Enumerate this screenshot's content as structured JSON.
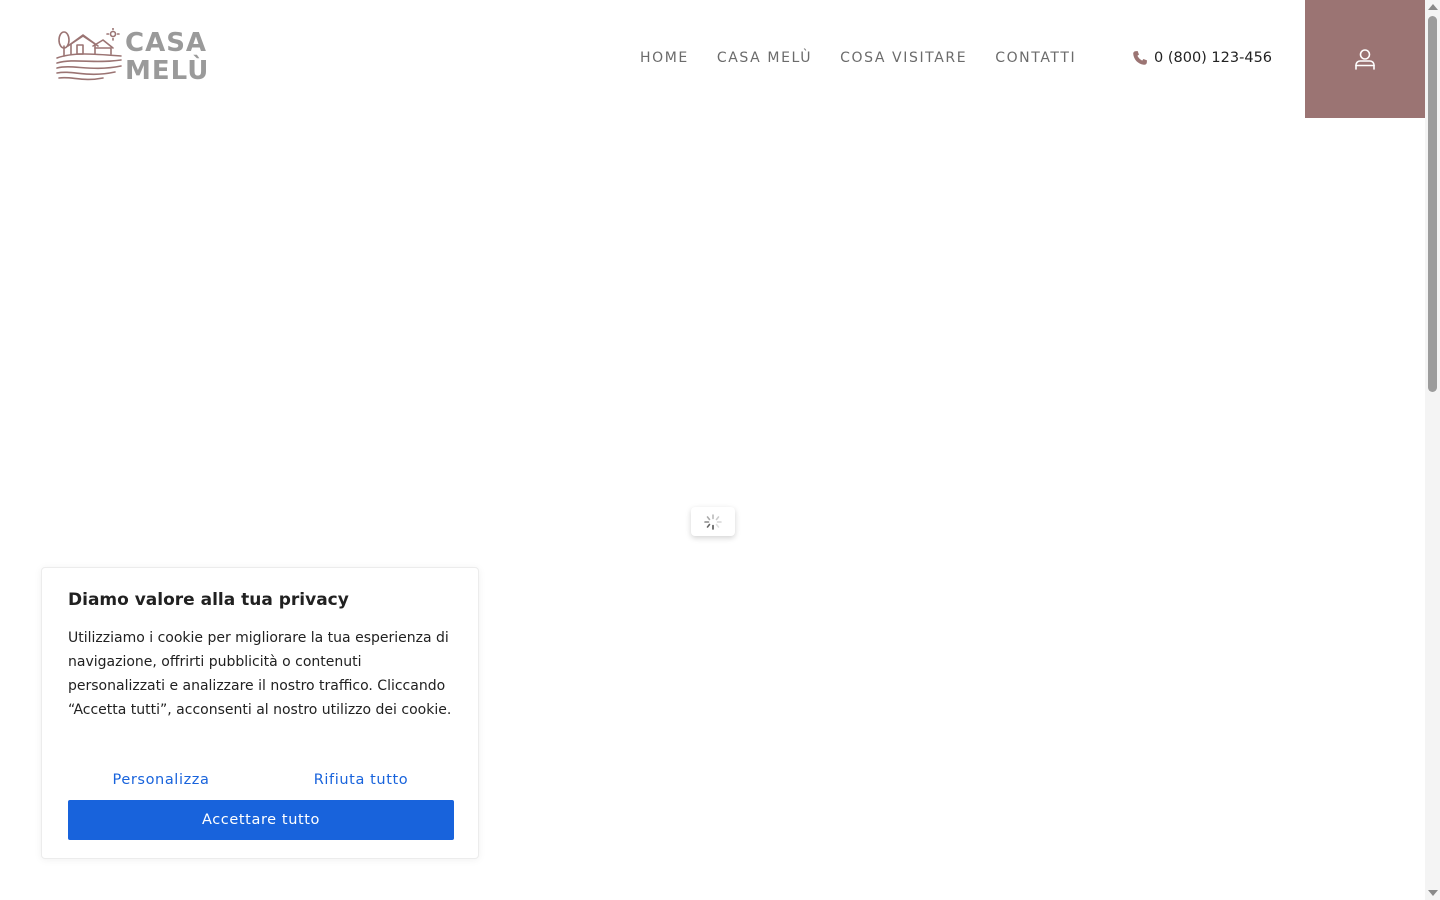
{
  "brand": {
    "name_line1": "CASA",
    "name_line2": "MELÙ",
    "logo_color": "#9b7473"
  },
  "nav": {
    "items": [
      {
        "label": "HOME"
      },
      {
        "label": "CASA MELÙ"
      },
      {
        "label": "COSA VISITARE"
      },
      {
        "label": "CONTATTI"
      }
    ]
  },
  "header": {
    "phone": "0 (800) 123-456",
    "phone_icon": "phone-icon",
    "account_icon": "user-icon",
    "accent_color": "#9b7473"
  },
  "loader": {
    "icon": "spinner-icon"
  },
  "cookie_banner": {
    "title": "Diamo valore alla tua privacy",
    "text": "Utilizziamo i cookie per migliorare la tua esperienza di navigazione, offrirti pubblicità o contenuti personalizzati e analizzare il nostro traffico. Cliccando “Accetta tutti”, acconsenti al nostro utilizzo dei cookie.",
    "customize_label": "Personalizza",
    "reject_label": "Rifiuta tutto",
    "accept_label": "Accettare tutto",
    "primary_color": "#1863dc"
  }
}
